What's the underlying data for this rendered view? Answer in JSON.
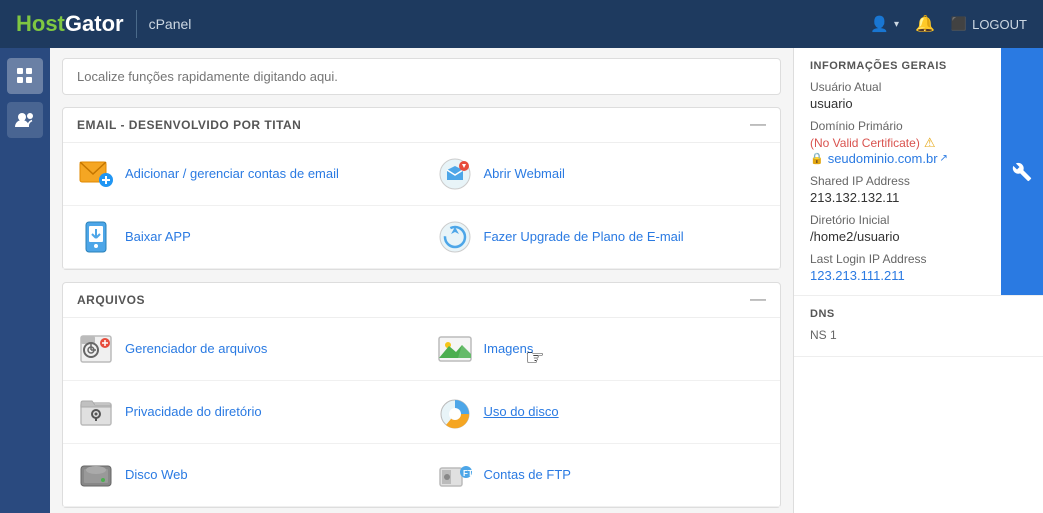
{
  "header": {
    "logo": "HostGator",
    "logo_accent": "Host",
    "app_name": "cPanel",
    "user_icon": "👤",
    "bell_icon": "🔔",
    "logout_label": "LOGOUT"
  },
  "search": {
    "placeholder": "Localize funções rapidamente digitando aqui."
  },
  "sections": [
    {
      "id": "email",
      "title": "EMAIL - DESENVOLVIDO POR TITAN",
      "items": [
        {
          "label": "Adicionar / gerenciar contas de email",
          "icon": "email-add"
        },
        {
          "label": "Abrir Webmail",
          "icon": "webmail"
        },
        {
          "label": "Baixar APP",
          "icon": "download-app"
        },
        {
          "label": "Fazer Upgrade de Plano de E-mail",
          "icon": "upgrade-email"
        }
      ]
    },
    {
      "id": "arquivos",
      "title": "ARQUIVOS",
      "items": [
        {
          "label": "Gerenciador de arquivos",
          "icon": "file-manager"
        },
        {
          "label": "Imagens",
          "icon": "images"
        },
        {
          "label": "Privacidade do diretório",
          "icon": "dir-privacy"
        },
        {
          "label": "Uso do disco",
          "icon": "disk-usage"
        },
        {
          "label": "Disco Web",
          "icon": "web-disk"
        },
        {
          "label": "Contas de FTP",
          "icon": "ftp"
        }
      ]
    }
  ],
  "right_panel": {
    "title": "INFORMAÇÕES GERAIS",
    "current_user_label": "Usuário Atual",
    "current_user_value": "usuario",
    "primary_domain_label": "Domínio Primário",
    "primary_domain_warning": "No Valid Certificate",
    "primary_domain_url": "seudominio.com.br",
    "shared_ip_label": "Shared IP Address",
    "shared_ip_value": "213.132.132.11",
    "home_dir_label": "Diretório Inicial",
    "home_dir_value": "/home2/usuario",
    "last_login_label": "Last Login IP Address",
    "last_login_value": "123.213.111.211",
    "dns_title": "DNS",
    "ns1_label": "NS 1"
  }
}
